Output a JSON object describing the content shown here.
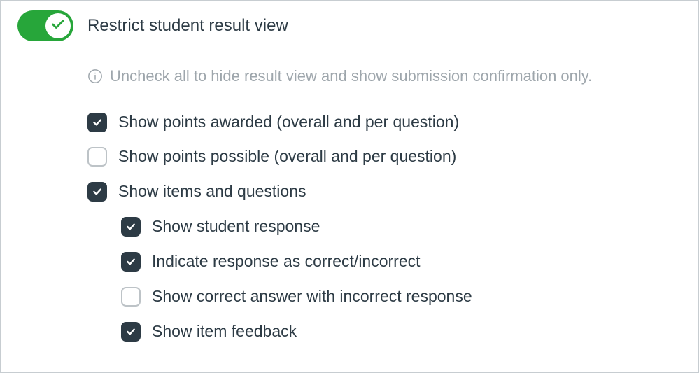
{
  "toggle": {
    "label": "Restrict student result view",
    "on": true
  },
  "helper": {
    "text": "Uncheck all to hide result view and show submission confirmation only."
  },
  "options": [
    {
      "key": "points_awarded",
      "label": "Show points awarded (overall and per question)",
      "checked": true
    },
    {
      "key": "points_possible",
      "label": "Show points possible (overall and per question)",
      "checked": false
    },
    {
      "key": "items_questions",
      "label": "Show items and questions",
      "checked": true
    }
  ],
  "nested_options": [
    {
      "key": "student_response",
      "label": "Show student response",
      "checked": true
    },
    {
      "key": "indicate_correct",
      "label": "Indicate response as correct/incorrect",
      "checked": true
    },
    {
      "key": "correct_answer",
      "label": "Show correct answer with incorrect response",
      "checked": false
    },
    {
      "key": "item_feedback",
      "label": "Show item feedback",
      "checked": true
    }
  ],
  "colors": {
    "toggle_on": "#27a63a",
    "checkbox_checked_bg": "#2d3b45",
    "text_primary": "#2d3b45",
    "text_muted": "#9ea6ac"
  }
}
